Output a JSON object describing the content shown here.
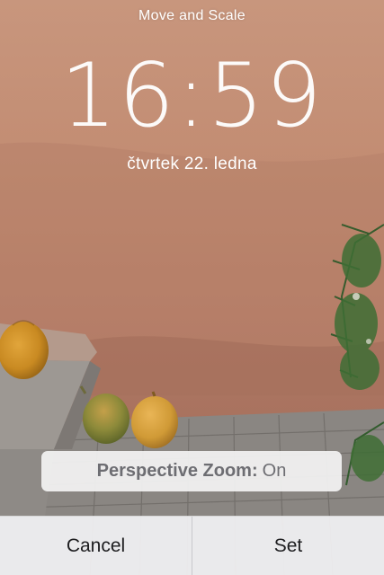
{
  "header": {
    "title": "Move and Scale"
  },
  "lock_screen": {
    "time": "16:59",
    "date": "čtvrtek 22. ledna"
  },
  "perspective_zoom": {
    "label": "Perspective Zoom",
    "separator": ":",
    "value": "On"
  },
  "actions": {
    "cancel_label": "Cancel",
    "set_label": "Set"
  },
  "colors": {
    "wall": "#c48e74",
    "text_overlay": "#ffffff",
    "toggle_text": "#6d6d72",
    "action_text": "#1d1d1f"
  }
}
